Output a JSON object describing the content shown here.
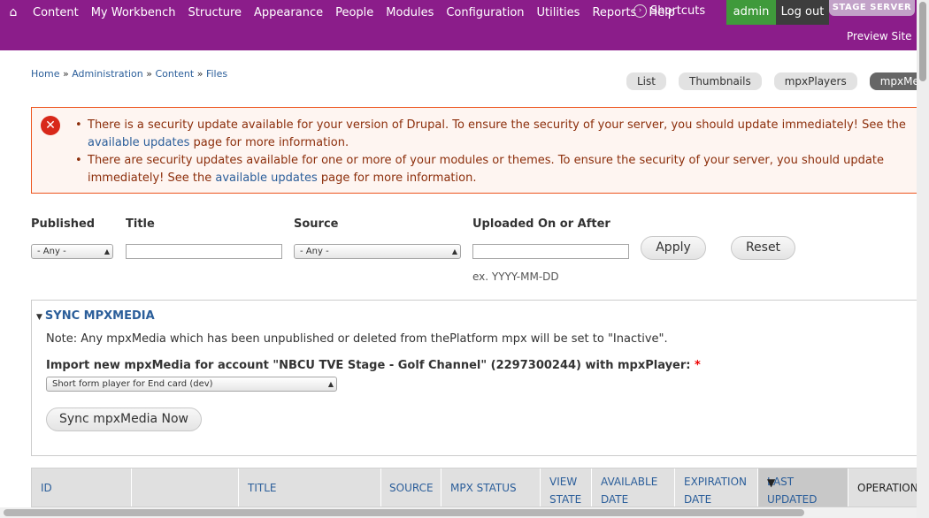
{
  "toolbar": {
    "menu": [
      "Content",
      "My Workbench",
      "Structure",
      "Appearance",
      "People",
      "Modules",
      "Configuration",
      "Utilities",
      "Reports",
      "Help"
    ],
    "shortcuts_label": "Shortcuts",
    "user": "admin",
    "logout": "Log out",
    "stage": "STAGE SERVER",
    "preview": "Preview Site"
  },
  "breadcrumb": {
    "items": [
      "Home",
      "Administration",
      "Content",
      "Files"
    ],
    "sep": " » "
  },
  "tabs": [
    "List",
    "Thumbnails",
    "mpxPlayers",
    "mpxMedia"
  ],
  "messages": {
    "m1_pre": "There is a security update available for your version of Drupal. To ensure the security of your server, you should update immediately! See the ",
    "m1_link": "available updates",
    "m1_post": " page for more information.",
    "m2_pre": "There are security updates available for one or more of your modules or themes. To ensure the security of your server, you should update immediately! See the ",
    "m2_link": "available updates",
    "m2_post": " page for more information."
  },
  "filters": {
    "published_label": "Published",
    "published_value": "- Any -",
    "title_label": "Title",
    "source_label": "Source",
    "source_value": "- Any -",
    "uploaded_label": "Uploaded On or After",
    "apply": "Apply",
    "reset": "Reset",
    "hint": "ex. YYYY-MM-DD"
  },
  "sync": {
    "legend": "SYNC MPXMEDIA",
    "note": "Note: Any mpxMedia which has been unpublished or deleted from thePlatform mpx will be set to \"Inactive\".",
    "import_label": "Import new mpxMedia for account \"NBCU TVE Stage - Golf Channel\" (2297300244) with mpxPlayer:",
    "required": "*",
    "player_value": "Short form player for End card (dev)",
    "button": "Sync mpxMedia Now"
  },
  "table": {
    "headers": [
      "ID",
      "",
      "TITLE",
      "SOURCE",
      "MPX STATUS",
      "VIEW STATE",
      "AVAILABLE DATE",
      "EXPIRATION DATE",
      "LAST UPDATED",
      "OPERATION"
    ]
  },
  "colors": {
    "toolbar": "#8b1d8a",
    "admin": "#3f9a3b",
    "link": "#2b5e9a",
    "error_border": "#ed541d",
    "error_text": "#8c2e0b"
  }
}
